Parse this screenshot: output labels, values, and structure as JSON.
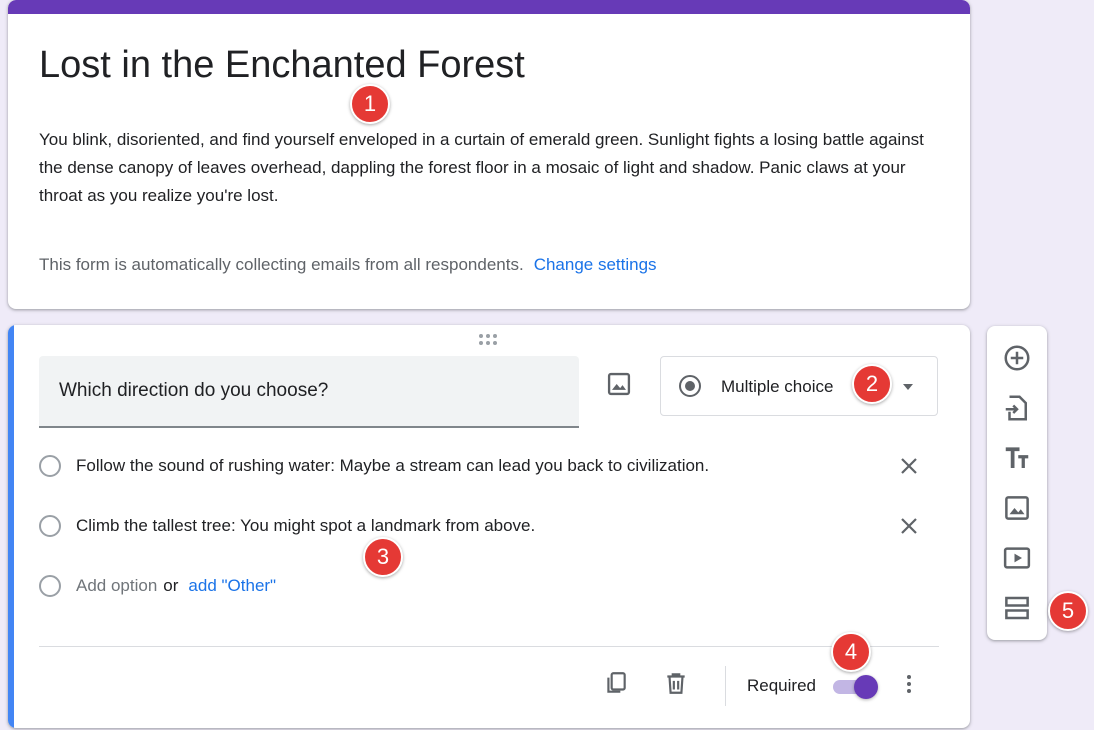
{
  "form": {
    "title": "Lost in the Enchanted Forest",
    "description": "You blink, disoriented, and find yourself enveloped in a curtain of emerald green. Sunlight fights a losing battle against the dense canopy of leaves overhead, dappling the forest floor in a mosaic of light and shadow. Panic claws at your throat as you realize you're lost.",
    "email_note": "This form is automatically collecting emails from all respondents.",
    "change_settings_label": "Change settings"
  },
  "question": {
    "title": "Which direction do you choose?",
    "type_label": "Multiple choice",
    "options": [
      "Follow the sound of rushing water: Maybe a stream can lead you back to civilization.",
      "Climb the tallest tree: You might spot a landmark from above."
    ],
    "add_option_label": "Add option",
    "or_label": "or",
    "add_other_label": "add \"Other\"",
    "required_label": "Required",
    "required": true
  },
  "markers": [
    "1",
    "2",
    "3",
    "4",
    "5"
  ],
  "icons": {
    "toolbar": [
      "add-question-icon",
      "import-questions-icon",
      "add-title-icon",
      "add-image-icon",
      "add-video-icon",
      "add-section-icon"
    ],
    "footer": [
      "duplicate-icon",
      "delete-icon",
      "more-vert-icon"
    ]
  },
  "colors": {
    "theme": "#673ab7",
    "active_accent": "#4285f4",
    "link": "#1a73e8",
    "background": "#efebf8",
    "marker": "#e53935"
  }
}
